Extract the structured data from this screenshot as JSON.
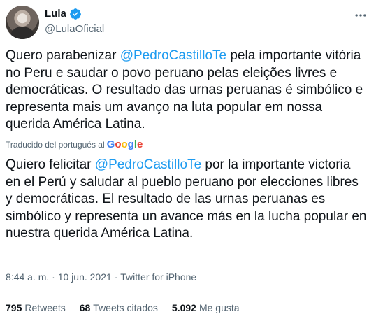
{
  "profile": {
    "name": "Lula",
    "handle": "@LulaOficial",
    "avatar_alt": "profile photo"
  },
  "original_text": {
    "part1": "Quero parabenizar ",
    "mention": "@PedroCastilloTe",
    "part2": " pela importante vitória no Peru e saudar o povo peruano pelas eleições livres e democráticas. O resultado das urnas peruanas é simbólico e representa mais um avanço na luta popular em nossa querida América Latina."
  },
  "translation": {
    "label": "Traducido del portugués al",
    "provider": "Google"
  },
  "translated_text": {
    "part1": "Quiero felicitar ",
    "mention": "@PedroCastilloTe",
    "part2": " por la importante victoria en el Perú y saludar al pueblo peruano por elecciones libres y democráticas. El resultado de las urnas peruanas es simbólico y representa un avance más en la lucha popular en nuestra querida América Latina."
  },
  "meta": {
    "time": "8:44 a. m.",
    "separator1": "·",
    "date": "10 jun. 2021",
    "separator2": "·",
    "source": "Twitter for iPhone"
  },
  "stats": {
    "retweets_count": "795",
    "retweets_label": "Retweets",
    "quotes_count": "68",
    "quotes_label": "Tweets citados",
    "likes_count": "5.092",
    "likes_label": "Me gusta"
  },
  "colors": {
    "accent": "#1d9bf0",
    "text": "#0f1419",
    "muted": "#536471"
  },
  "icons": {
    "verified": "verified-badge-icon",
    "more": "more-options-icon"
  }
}
